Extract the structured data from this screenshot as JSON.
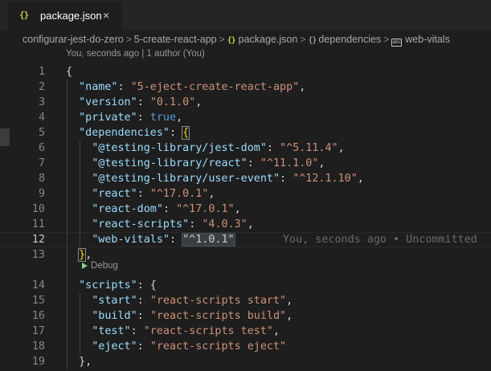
{
  "tab": {
    "icon": "{}",
    "label": "package.json",
    "close": "×"
  },
  "breadcrumb": {
    "items": [
      {
        "label": "configurar-jest-do-zero",
        "icon": ""
      },
      {
        "label": "5-create-react-app",
        "icon": ""
      },
      {
        "label": "package.json",
        "icon": "{}"
      },
      {
        "label": "dependencies",
        "icon": "{}"
      },
      {
        "label": "web-vitals",
        "icon": "abc"
      }
    ],
    "separator": ">"
  },
  "codelens": {
    "blame": "You, seconds ago | 1 author (You)",
    "debug": "Debug"
  },
  "editor": {
    "ghost_text": "You, seconds ago • Uncommitted",
    "lines": [
      {
        "n": "1",
        "tokens": [
          [
            "p",
            "{"
          ]
        ]
      },
      {
        "n": "2",
        "tokens": [
          [
            "p",
            "  "
          ],
          [
            "k",
            "\"name\""
          ],
          [
            "p",
            ": "
          ],
          [
            "s",
            "\"5-eject-create-react-app\""
          ],
          [
            "p",
            ","
          ]
        ]
      },
      {
        "n": "3",
        "tokens": [
          [
            "p",
            "  "
          ],
          [
            "k",
            "\"version\""
          ],
          [
            "p",
            ": "
          ],
          [
            "s",
            "\"0.1.0\""
          ],
          [
            "p",
            ","
          ]
        ]
      },
      {
        "n": "4",
        "tokens": [
          [
            "p",
            "  "
          ],
          [
            "k",
            "\"private\""
          ],
          [
            "p",
            ": "
          ],
          [
            "b",
            "true"
          ],
          [
            "p",
            ","
          ]
        ]
      },
      {
        "n": "5",
        "tokens": [
          [
            "p",
            "  "
          ],
          [
            "k",
            "\"dependencies\""
          ],
          [
            "p",
            ": "
          ],
          [
            "brk",
            "{"
          ]
        ]
      },
      {
        "n": "6",
        "tokens": [
          [
            "p",
            "    "
          ],
          [
            "k",
            "\"@testing-library/jest-dom\""
          ],
          [
            "p",
            ": "
          ],
          [
            "s",
            "\"^5.11.4\""
          ],
          [
            "p",
            ","
          ]
        ]
      },
      {
        "n": "7",
        "tokens": [
          [
            "p",
            "    "
          ],
          [
            "k",
            "\"@testing-library/react\""
          ],
          [
            "p",
            ": "
          ],
          [
            "s",
            "\"^11.1.0\""
          ],
          [
            "p",
            ","
          ]
        ]
      },
      {
        "n": "8",
        "tokens": [
          [
            "p",
            "    "
          ],
          [
            "k",
            "\"@testing-library/user-event\""
          ],
          [
            "p",
            ": "
          ],
          [
            "s",
            "\"^12.1.10\""
          ],
          [
            "p",
            ","
          ]
        ]
      },
      {
        "n": "9",
        "tokens": [
          [
            "p",
            "    "
          ],
          [
            "k",
            "\"react\""
          ],
          [
            "p",
            ": "
          ],
          [
            "s",
            "\"^17.0.1\""
          ],
          [
            "p",
            ","
          ]
        ]
      },
      {
        "n": "10",
        "tokens": [
          [
            "p",
            "    "
          ],
          [
            "k",
            "\"react-dom\""
          ],
          [
            "p",
            ": "
          ],
          [
            "s",
            "\"^17.0.1\""
          ],
          [
            "p",
            ","
          ]
        ]
      },
      {
        "n": "11",
        "tokens": [
          [
            "p",
            "    "
          ],
          [
            "k",
            "\"react-scripts\""
          ],
          [
            "p",
            ": "
          ],
          [
            "s",
            "\"4.0.3\""
          ],
          [
            "p",
            ","
          ]
        ]
      },
      {
        "n": "12",
        "tokens": [
          [
            "p",
            "    "
          ],
          [
            "k",
            "\"web-vitals\""
          ],
          [
            "p",
            ": "
          ],
          [
            "sel",
            "\"^1.0.1\""
          ]
        ]
      },
      {
        "n": "13",
        "tokens": [
          [
            "p",
            "  "
          ],
          [
            "brk",
            "}"
          ],
          [
            "p",
            ","
          ]
        ]
      },
      {
        "n": "14",
        "tokens": [
          [
            "p",
            "  "
          ],
          [
            "k",
            "\"scripts\""
          ],
          [
            "p",
            ": {"
          ]
        ]
      },
      {
        "n": "15",
        "tokens": [
          [
            "p",
            "    "
          ],
          [
            "k",
            "\"start\""
          ],
          [
            "p",
            ": "
          ],
          [
            "s",
            "\"react-scripts start\""
          ],
          [
            "p",
            ","
          ]
        ]
      },
      {
        "n": "16",
        "tokens": [
          [
            "p",
            "    "
          ],
          [
            "k",
            "\"build\""
          ],
          [
            "p",
            ": "
          ],
          [
            "s",
            "\"react-scripts build\""
          ],
          [
            "p",
            ","
          ]
        ]
      },
      {
        "n": "17",
        "tokens": [
          [
            "p",
            "    "
          ],
          [
            "k",
            "\"test\""
          ],
          [
            "p",
            ": "
          ],
          [
            "s",
            "\"react-scripts test\""
          ],
          [
            "p",
            ","
          ]
        ]
      },
      {
        "n": "18",
        "tokens": [
          [
            "p",
            "    "
          ],
          [
            "k",
            "\"eject\""
          ],
          [
            "p",
            ": "
          ],
          [
            "s",
            "\"react-scripts eject\""
          ]
        ]
      },
      {
        "n": "19",
        "tokens": [
          [
            "p",
            "  "
          ],
          [
            "p",
            "},"
          ]
        ]
      }
    ]
  }
}
